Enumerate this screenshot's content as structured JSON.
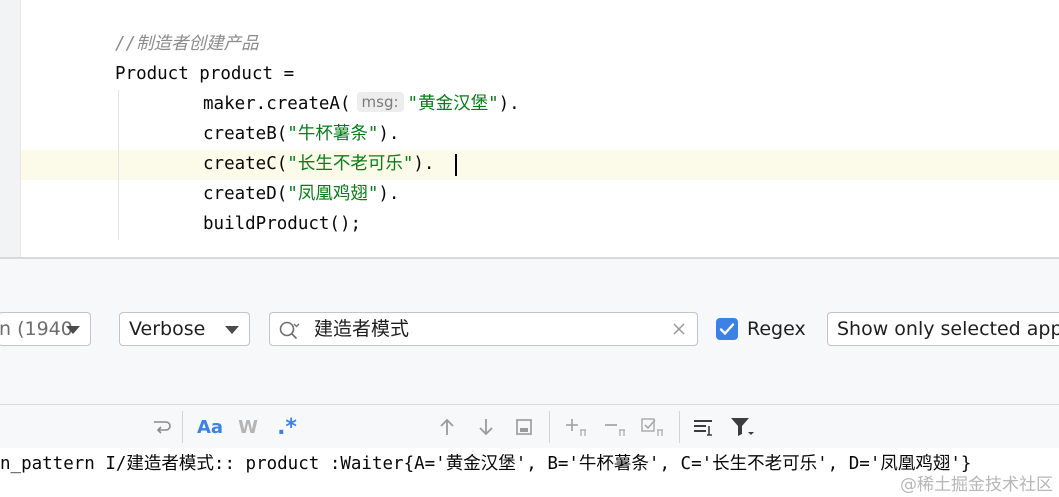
{
  "editor": {
    "comment": "//制造者创建产品",
    "line_product": "Product product =",
    "line_create_a_prefix": "maker.createA(",
    "hint_msg": "msg:",
    "str_a": "\"黄金汉堡\"",
    "line_create_a_suffix": ").",
    "line_create_b_prefix": "createB(",
    "str_b": "\"牛杯薯条\"",
    "line_create_b_suffix": ").",
    "line_create_c_prefix": "createC(",
    "str_c": "\"长生不老可乐\"",
    "line_create_c_suffix": ").",
    "line_create_d_prefix": "createD(",
    "str_d": "\"凤凰鸡翅\"",
    "line_create_d_suffix": ").",
    "line_build": "buildProduct();"
  },
  "filter_bar": {
    "process_combo_value": "n (1940",
    "level_combo_value": "Verbose",
    "search_value": "建造者模式",
    "regex_label": "Regex",
    "regex_checked": true,
    "scope_combo_value": "Show only selected applic"
  },
  "toolbar": {
    "match_case_label": "Aa",
    "words_label": "W",
    "regex_toggle_label": ".*"
  },
  "log": {
    "line": "n_pattern I/建造者模式:: product :Waiter{A='黄金汉堡', B='牛杯薯条', C='长生不老可乐', D='凤凰鸡翅'}"
  },
  "watermark": "@稀土掘金技术社区",
  "colors": {
    "accent": "#3c82e6",
    "string": "#067d17",
    "comment": "#8c8c8c",
    "current_line": "#fcfae9"
  },
  "icons": [
    "search-icon",
    "clear-icon",
    "check-icon",
    "soft-wrap-icon",
    "arrow-up-icon",
    "arrow-down-icon",
    "scroll-to-end-icon",
    "add-filter-icon",
    "remove-filter-icon",
    "check-filter-icon",
    "format-icon",
    "filter-icon"
  ]
}
